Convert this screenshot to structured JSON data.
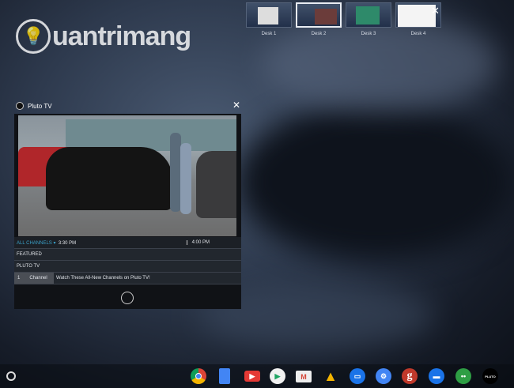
{
  "desks": [
    {
      "label": "Desk 1"
    },
    {
      "label": "Desk 2",
      "active": true
    },
    {
      "label": "Desk 3"
    },
    {
      "label": "Desk 4"
    }
  ],
  "watermark": {
    "text": "uantrimang",
    "logo_letter": "Q"
  },
  "window": {
    "title": "Pluto TV",
    "close": "✕"
  },
  "guide": {
    "all_channels": "ALL CHANNELS ▾",
    "time1": "3:30 PM",
    "time2": "4:00 PM",
    "featured": "FEATURED",
    "pluto": "PLUTO TV",
    "channel_num": "1",
    "channel_name": "Channel",
    "program": "Watch These All-New Channels on Pluto TV!"
  },
  "shelf": [
    {
      "name": "chrome",
      "color": "#db4437"
    },
    {
      "name": "docs",
      "color": "#4285f4"
    },
    {
      "name": "youtube",
      "color": "#e53935"
    },
    {
      "name": "play-store",
      "color": "#f1f1f1"
    },
    {
      "name": "gmail",
      "color": "#d44638"
    },
    {
      "name": "drive",
      "color": "#1fa463"
    },
    {
      "name": "messages",
      "color": "#1a73e8"
    },
    {
      "name": "settings",
      "color": "#4285f4"
    },
    {
      "name": "g-app",
      "color": "#c0392b",
      "letter": "g"
    },
    {
      "name": "files",
      "color": "#1a73e8"
    },
    {
      "name": "android-app",
      "color": "#2e9e44"
    },
    {
      "name": "pluto-tv",
      "color": "#000000",
      "letter": "PLUTO"
    }
  ]
}
